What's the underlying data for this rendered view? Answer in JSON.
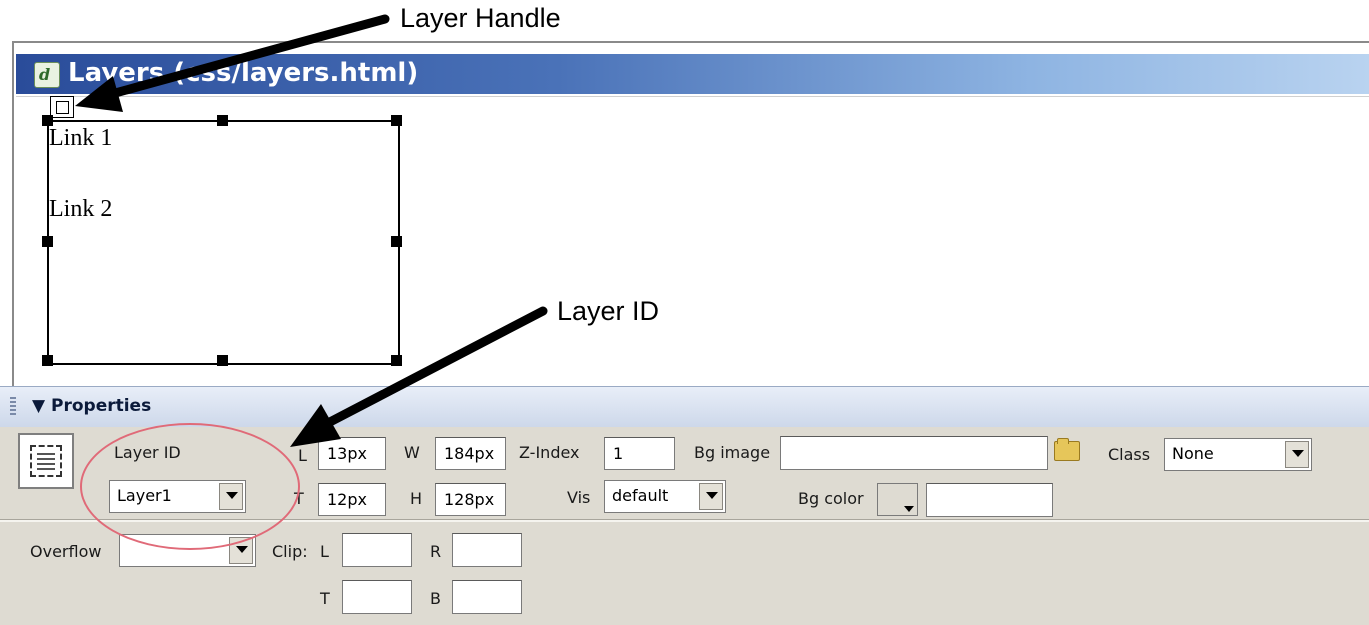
{
  "annotations": {
    "layer_handle": "Layer Handle",
    "layer_id": "Layer ID"
  },
  "document": {
    "title": "Layers (css/layers.html)",
    "icon": "dreamweaver-document-icon",
    "links": [
      "Link 1",
      "Link 2"
    ]
  },
  "properties": {
    "header": "Properties",
    "layer_id_label": "Layer ID",
    "layer_id_value": "Layer1",
    "left_label": "L",
    "left_value": "13px",
    "top_label": "T",
    "top_value": "12px",
    "width_label": "W",
    "width_value": "184px",
    "height_label": "H",
    "height_value": "128px",
    "zindex_label": "Z-Index",
    "zindex_value": "1",
    "vis_label": "Vis",
    "vis_value": "default",
    "bg_image_label": "Bg image",
    "bg_image_value": "",
    "bg_color_label": "Bg color",
    "bg_color_value": "",
    "class_label": "Class",
    "class_value": "None",
    "overflow_label": "Overflow",
    "overflow_value": "",
    "clip_label": "Clip:",
    "clip_l_label": "L",
    "clip_r_label": "R",
    "clip_t_label": "T",
    "clip_b_label": "B",
    "clip_l_value": "",
    "clip_r_value": "",
    "clip_t_value": "",
    "clip_b_value": ""
  },
  "colors": {
    "titlebar_dark": "#2a4c9a",
    "titlebar_light": "#b9d3f0",
    "panel_bg": "#dedbd2",
    "highlight_ellipse": "#e06a78"
  }
}
